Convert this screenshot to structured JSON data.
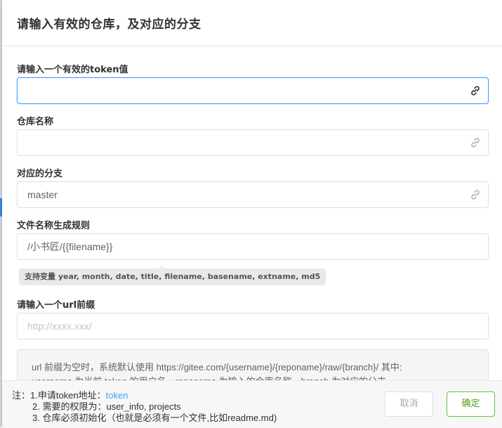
{
  "dialog": {
    "title": "请输入有效的仓库，及对应的分支"
  },
  "fields": {
    "token": {
      "label": "请输入一个有效的token值",
      "value": "",
      "placeholder": ""
    },
    "repo": {
      "label": "仓库名称",
      "value": "",
      "placeholder": ""
    },
    "branch": {
      "label": "对应的分支",
      "value": "master",
      "placeholder": ""
    },
    "filename_rule": {
      "label": "文件名称生成规则",
      "value": "/小书匠/{{filename}}",
      "placeholder": ""
    },
    "url_prefix": {
      "label": "请输入一个url前缀",
      "value": "",
      "placeholder": "http://xxxx.xxx/"
    }
  },
  "tip": "支持变量 year, month, date, title, filename, basename, extname, md5",
  "info": {
    "line1": "url 前缀为空时，系统默认使用 https://gitee.com/{username}/{reponame}/raw/{branch}/ 其中:",
    "line2": "username 为当前 token 的用户名，reponame 为输入的仓库名称，branch 为对应的分支"
  },
  "footer": {
    "note1_prefix": "注：1.申请token地址：",
    "note1_link": "token",
    "note2": "2. 需要的权限为：user_info, projects",
    "note3": "3. 仓库必须初始化（也就是必须有一个文件,比如readme.md)",
    "cancel_label": "取消",
    "confirm_label": "确定"
  },
  "icons": {
    "link": "link-icon"
  },
  "colors": {
    "accent": "#409eff",
    "confirm": "#67c23a"
  }
}
